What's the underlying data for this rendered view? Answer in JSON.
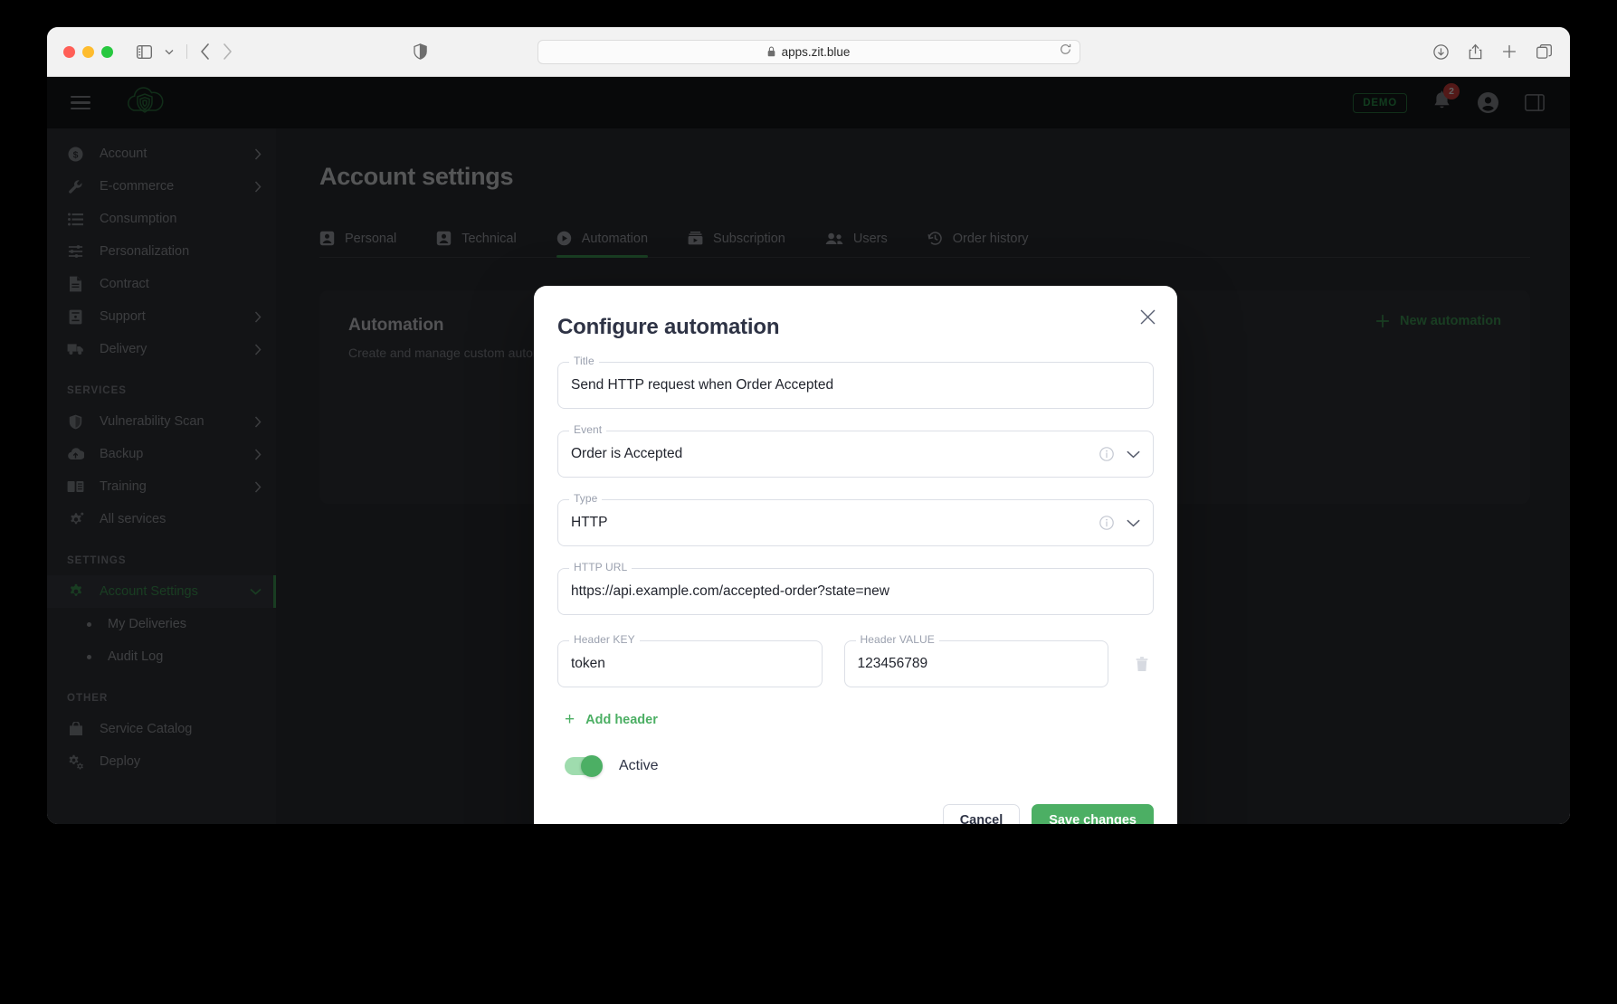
{
  "browser": {
    "url": "apps.zit.blue",
    "lock_icon": "lock-icon",
    "sidebar_toggle_icon": "sidebar-toggle-icon",
    "back_icon": "back-arrow-icon",
    "forward_icon": "forward-arrow-icon",
    "shield_icon": "privacy-shield-icon",
    "reload_icon": "reload-icon",
    "downloads_icon": "downloads-icon",
    "share_icon": "share-icon",
    "new_tab_icon": "plus-icon",
    "tab_overview_icon": "tab-overview-icon"
  },
  "appbar": {
    "menu_icon": "hamburger-menu-icon",
    "logo_icon": "cloud-logo-icon",
    "demo_badge": "DEMO",
    "notification_icon": "bell-icon",
    "notification_count": "2",
    "account_icon": "account-circle-icon",
    "panel_icon": "side-panel-icon"
  },
  "sidebar": {
    "items": [
      {
        "label": "Account",
        "icon": "dollar-circle-icon",
        "chevron": true
      },
      {
        "label": "E-commerce",
        "icon": "wrench-icon",
        "chevron": true
      },
      {
        "label": "Consumption",
        "icon": "list-icon",
        "chevron": false
      },
      {
        "label": "Personalization",
        "icon": "sliders-icon",
        "chevron": false
      },
      {
        "label": "Contract",
        "icon": "document-icon",
        "chevron": false
      },
      {
        "label": "Support",
        "icon": "support-icon",
        "chevron": true
      },
      {
        "label": "Delivery",
        "icon": "truck-icon",
        "chevron": true
      }
    ],
    "services_title": "SERVICES",
    "services": [
      {
        "label": "Vulnerability Scan",
        "icon": "shield-icon",
        "chevron": true
      },
      {
        "label": "Backup",
        "icon": "cloud-upload-icon",
        "chevron": true
      },
      {
        "label": "Training",
        "icon": "book-icon",
        "chevron": true
      },
      {
        "label": "All services",
        "icon": "gear-sparkle-icon",
        "chevron": false
      }
    ],
    "settings_title": "SETTINGS",
    "settings": [
      {
        "label": "Account Settings",
        "icon": "gear-icon",
        "chevron": true,
        "active": true
      }
    ],
    "settings_sub": [
      {
        "label": "My Deliveries"
      },
      {
        "label": "Audit Log"
      }
    ],
    "other_title": "OTHER",
    "other": [
      {
        "label": "Service Catalog",
        "icon": "bag-icon",
        "chevron": false
      },
      {
        "label": "Deploy",
        "icon": "gears-icon",
        "chevron": false
      }
    ]
  },
  "main": {
    "page_title": "Account settings",
    "tabs": [
      {
        "label": "Personal",
        "icon": "person-icon",
        "active": false
      },
      {
        "label": "Technical",
        "icon": "person-icon",
        "active": false
      },
      {
        "label": "Automation",
        "icon": "automation-icon",
        "active": true
      },
      {
        "label": "Subscription",
        "icon": "subscription-icon",
        "active": false
      },
      {
        "label": "Users",
        "icon": "users-icon",
        "active": false
      },
      {
        "label": "Order history",
        "icon": "history-icon",
        "active": false
      }
    ],
    "card": {
      "title": "Automation",
      "subtitle": "Create and manage custom automations",
      "new_button": "New automation",
      "new_button_icon": "plus-icon"
    }
  },
  "modal": {
    "title": "Configure automation",
    "close_icon": "close-icon",
    "fields": {
      "title": {
        "legend": "Title",
        "value": "Send HTTP request when Order Accepted"
      },
      "event": {
        "legend": "Event",
        "value": "Order is Accepted",
        "info_icon": "info-icon",
        "chevron_icon": "chevron-down-icon"
      },
      "type": {
        "legend": "Type",
        "value": "HTTP",
        "info_icon": "info-icon",
        "chevron_icon": "chevron-down-icon"
      },
      "http_url": {
        "legend": "HTTP URL",
        "value": "https://api.example.com/accepted-order?state=new"
      },
      "header_key": {
        "legend": "Header KEY",
        "value": "token"
      },
      "header_value": {
        "legend": "Header VALUE",
        "value": "123456789"
      }
    },
    "delete_header_icon": "trash-icon",
    "add_header_label": "Add header",
    "add_header_icon": "plus-icon",
    "toggle_label": "Active",
    "toggle_on": true,
    "cancel_label": "Cancel",
    "save_label": "Save changes",
    "accent_color": "#4caf64"
  }
}
